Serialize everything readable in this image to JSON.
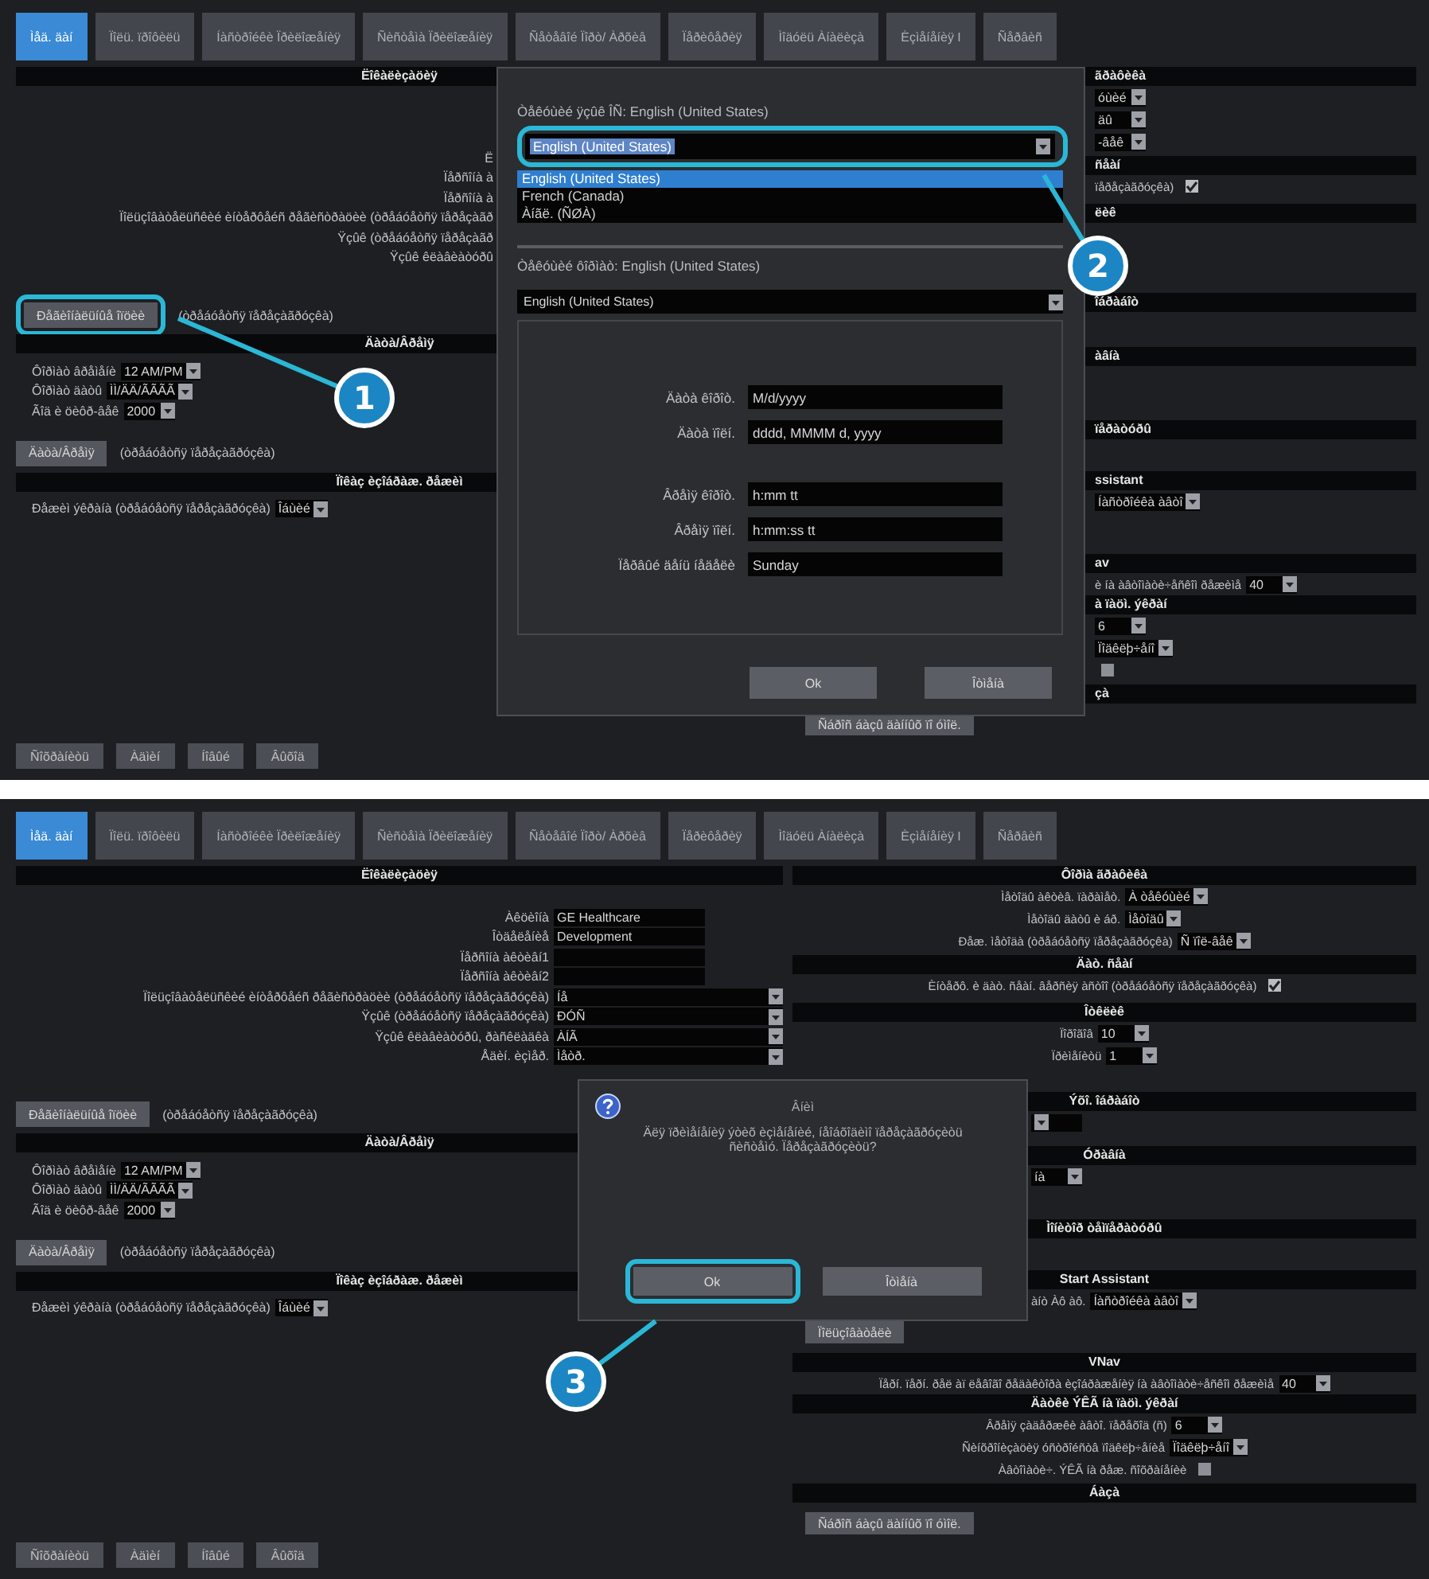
{
  "panels": [
    {
      "tabs": [
        {
          "label": "Ìåä. äàí",
          "selected": true
        },
        {
          "label": "Ïîëü. ïðîôèëü",
          "selected": false
        },
        {
          "label": "Íàñòðîéêè Ïðèëîæåíèÿ",
          "selected": false
        },
        {
          "label": "Ñèñòåìà Ïðèëîæåíèÿ",
          "selected": false
        },
        {
          "label": "Ñåòåâîé Ïîðò/ Àðõèâ",
          "selected": false
        },
        {
          "label": "Ïåðèôåðèÿ",
          "selected": false
        },
        {
          "label": "Ìîäóëü Àíàëèçà",
          "selected": false
        },
        {
          "label": "Èçìåíåíèÿ I",
          "selected": false
        },
        {
          "label": "Ñåðâèñ",
          "selected": false
        }
      ],
      "left": [
        {
          "kind": "form",
          "title": "Ëîêàëèçàöèÿ",
          "rows": [
            {
              "kind": "label",
              "label": "Ë"
            },
            {
              "kind": "label",
              "label": "Ïåðñîíà à"
            },
            {
              "kind": "label",
              "label": "Ïåðñîíà à"
            },
            {
              "kind": "label",
              "label": "Ïîëüçîâàòåëüñêèé èíòåðôåéñ ðåãèñòðàöèè (òðåáóåòñÿ ïåðåçàãð"
            },
            {
              "kind": "label",
              "label": "Ÿçûê (òðåáóåòñÿ ïåðåçàãð"
            },
            {
              "kind": "label",
              "label": "Ÿçûê êëàâèàòóðû"
            }
          ]
        },
        {
          "kind": "bar",
          "rows": [
            {
              "kind": "button",
              "label": "Ðåãèîíàëüíûå îïöèè",
              "note": "(òðåáóåòñÿ ïåðåçàãðóçêà)",
              "highlighted": true
            }
          ]
        },
        {
          "kind": "list",
          "title": "Äàòà/Âðåìÿ",
          "rows": [
            {
              "kind": "select",
              "label": "Ôîðìàò âðåìåíè",
              "value": "12 AM/PM"
            },
            {
              "kind": "select",
              "label": "Ôîðìàò äàòû",
              "value": "ÌÌ/ÄÄ/ÃÃÃÃ"
            },
            {
              "kind": "select",
              "label": "Ãîä è öèôð-âåê",
              "value": "2000"
            }
          ]
        },
        {
          "kind": "bar",
          "rows": [
            {
              "kind": "button",
              "label": "Äàòà/Âðåìÿ",
              "note": "(òðåáóåòñÿ ïåðåçàãðóçêà)",
              "highlighted": false
            }
          ]
        },
        {
          "kind": "list",
          "title": "Ïîêàç èçîáðàæ. ðåæèì",
          "rows": [
            {
              "kind": "select",
              "label": "Ðåæèì ýêðàíà (òðåáóåòñÿ ïåðåçàãðóçêà)",
              "value": "Îáùèé"
            }
          ]
        }
      ],
      "right": [
        {
          "title": "ãðàôèêà",
          "partial": true,
          "rows": [
            {
              "kind": "select",
              "value": "óùèé",
              "partial": true
            },
            {
              "kind": "select",
              "value": "äû",
              "partial": true
            },
            {
              "kind": "select",
              "value": "-âåê",
              "partial": true
            }
          ]
        },
        {
          "title": "ñåàí",
          "partial": true,
          "rows": [
            {
              "kind": "check",
              "label": "ïåðåçàãðóçêà)",
              "checked": true,
              "partial": true
            }
          ]
        },
        {
          "title": "ëèê",
          "partial": true
        },
        {
          "title": "îáðàáîò",
          "partial": true
        },
        {
          "title": "àâíà",
          "partial": true
        },
        {
          "title": "ïåðàòóðû",
          "partial": true
        },
        {
          "title": "ssistant",
          "partial": true,
          "rows": [
            {
              "kind": "select",
              "value": "Íàñòðîéêà àâòî",
              "partial": true
            }
          ]
        },
        {
          "title": "av",
          "partial": true,
          "rows": [
            {
              "kind": "select",
              "label": "è íà àâòîìàòè÷åñêîì ðåæèìå",
              "value": "40",
              "partial": true
            }
          ]
        },
        {
          "title": "à ïàöì. ýêðàí",
          "partial": true,
          "rows": [
            {
              "kind": "select",
              "value": "6",
              "partial": true
            },
            {
              "kind": "select",
              "value": "Ïîäêëþ÷åíî",
              "partial": true
            },
            {
              "kind": "check",
              "checked": false
            }
          ]
        },
        {
          "title": "çà",
          "partial": true,
          "rows": [
            {
              "kind": "button",
              "label": "Ñáðîñ áàçû äàííûõ ïî óìîë."
            }
          ]
        }
      ],
      "footer": [
        "Ñîõðàíèòü",
        "Àäìèí",
        "Íîâûé",
        "Âûõîä"
      ],
      "dialog": {
        "kind": "locale",
        "current_label": "Òåêóùèé ÿçûê ÎÑ: English (United States)",
        "current": "English (United States)",
        "highlighted": true,
        "options": [
          {
            "label": "English (United States)",
            "selected": true
          },
          {
            "label": "French (Canada)",
            "selected": false
          },
          {
            "label": "Àíãë. (ÑØÀ)",
            "selected": false
          }
        ],
        "format_label": "Òåêóùèé ôîðìàò: English (United States)",
        "format": "English (United States)",
        "date_formats": [
          {
            "label": "Äàòà êîðîò.",
            "value": "M/d/yyyy"
          },
          {
            "label": "Äàòà ïîëí.",
            "value": "dddd, MMMM d, yyyy"
          }
        ],
        "time_formats": [
          {
            "label": "Âðåìÿ êîðîò.",
            "value": "h:mm tt"
          },
          {
            "label": "Âðåìÿ ïîëí.",
            "value": "h:mm:ss tt"
          },
          {
            "label": "Ïåðâûé äåíü íåäåëè",
            "value": "Sunday"
          }
        ],
        "buttons": [
          {
            "label": "Ok",
            "highlighted": false
          },
          {
            "label": "Îòìåíà",
            "highlighted": false
          }
        ]
      },
      "callouts": [
        {
          "number": "1"
        },
        {
          "number": "2"
        }
      ]
    },
    {
      "tabs": [
        {
          "label": "Ìåä. äàí",
          "selected": true
        },
        {
          "label": "Ïîëü. ïðîôèëü",
          "selected": false
        },
        {
          "label": "Íàñòðîéêè Ïðèëîæåíèÿ",
          "selected": false
        },
        {
          "label": "Ñèñòåìà Ïðèëîæåíèÿ",
          "selected": false
        },
        {
          "label": "Ñåòåâîé Ïîðò/ Àðõèâ",
          "selected": false
        },
        {
          "label": "Ïåðèôåðèÿ",
          "selected": false
        },
        {
          "label": "Ìîäóëü Àíàëèçà",
          "selected": false
        },
        {
          "label": "Èçìåíåíèÿ I",
          "selected": false
        },
        {
          "label": "Ñåðâèñ",
          "selected": false
        }
      ],
      "left": [
        {
          "kind": "form",
          "title": "Ëîêàëèçàöèÿ",
          "rows": [
            {
              "kind": "field",
              "label": "Àêöèîíà",
              "value": "GE Healthcare"
            },
            {
              "kind": "field",
              "label": "Îòäåëåíèå",
              "value": "Development"
            },
            {
              "kind": "field",
              "label": "Ïåðñîíà àêòèâí1"
            },
            {
              "kind": "field",
              "label": "Ïåðñîíà àêòèâí2"
            },
            {
              "kind": "select",
              "label": "Ïîëüçîâàòåëüñêèé èíòåðôåéñ ðåãèñòðàöèè (òðåáóåòñÿ ïåðåçàãðóçêà)",
              "value": "Íå"
            },
            {
              "kind": "select",
              "label": "Ÿçûê (òðåáóåòñÿ ïåðåçàãðóçêà)",
              "value": "ÐÓÑ"
            },
            {
              "kind": "select",
              "label": "Ÿçûê êëàâèàòóðû, ðàñêëàäêà",
              "value": "ÀÍÃ"
            },
            {
              "kind": "select",
              "label": "Åäèí. èçìåð.",
              "value": "Ìåòð."
            }
          ]
        },
        {
          "kind": "bar",
          "rows": [
            {
              "kind": "button",
              "label": "Ðåãèîíàëüíûå îïöèè",
              "note": "(òðåáóåòñÿ ïåðåçàãðóçêà)",
              "highlighted": false
            }
          ]
        },
        {
          "kind": "list",
          "title": "Äàòà/Âðåìÿ",
          "rows": [
            {
              "kind": "select",
              "label": "Ôîðìàò âðåìåíè",
              "value": "12 AM/PM"
            },
            {
              "kind": "select",
              "label": "Ôîðìàò äàòû",
              "value": "ÌÌ/ÄÄ/ÃÃÃÃ"
            },
            {
              "kind": "select",
              "label": "Ãîä è öèôð-âåê",
              "value": "2000"
            }
          ]
        },
        {
          "kind": "bar",
          "rows": [
            {
              "kind": "button",
              "label": "Äàòà/Âðåìÿ",
              "note": "(òðåáóåòñÿ ïåðåçàãðóçêà)",
              "highlighted": false
            }
          ]
        },
        {
          "kind": "list",
          "title": "Ïîêàç èçîáðàæ. ðåæèì",
          "rows": [
            {
              "kind": "select",
              "label": "Ðåæèì ýêðàíà (òðåáóåòñÿ ïåðåçàãðóçêà)",
              "value": "Îáùèé"
            }
          ]
        }
      ],
      "right": [
        {
          "title": "Ôîðìà ãðàôèêà",
          "partial": false,
          "rows": [
            {
              "kind": "select",
              "label": "Ìåòîäû àêòèâ. ïàðàìåò.",
              "value": "À òåêóùèé",
              "partial": false
            },
            {
              "kind": "select",
              "label": "Ìåòîäû äàòû è áð.",
              "value": "Ìåòîäû",
              "partial": false
            },
            {
              "kind": "select",
              "label": "Ðåæ. ìåòîäà (òðåáóåòñÿ ïåðåçàãðóçêà)",
              "value": "Ñ ïîë-âåê",
              "partial": false
            }
          ]
        },
        {
          "title": "Äàò. ñåàí",
          "partial": false,
          "rows": [
            {
              "kind": "check",
              "label": "Èíòåðô. è äàò. ñåàí. âåðñèÿ àñòîî (òðåáóåòñÿ ïåðåçàãðóçêà)",
              "checked": true,
              "partial": false
            }
          ]
        },
        {
          "title": "Îòêëèê",
          "partial": false,
          "rows": [
            {
              "kind": "select",
              "label": "Ïîðîãîâ",
              "value": "10",
              "partial": false
            },
            {
              "kind": "select",
              "label": "Ïðèìåíèòü",
              "value": "1",
              "partial": false
            }
          ]
        },
        {
          "title": "Ýõî. îáðàáîò",
          "partial": false,
          "rows": [
            {
              "kind": "select",
              "partial": true
            }
          ]
        },
        {
          "title": "Óðàâíà",
          "partial": false,
          "rows": [
            {
              "kind": "select",
              "value": "íà",
              "partial": true
            }
          ]
        },
        {
          "title": "Ìîíèòîð òåìïåðàòóðû",
          "partial": false
        },
        {
          "title": "Start Assistant",
          "partial": false,
          "rows": [
            {
              "kind": "select",
              "label": "àíò Àô àô.",
              "value": "Íàñòðîéêà àâòî",
              "partial": true
            },
            {
              "kind": "button",
              "label": "Ïîëüçîâàòåëè"
            }
          ]
        },
        {
          "title": "VNav",
          "partial": false,
          "rows": [
            {
              "kind": "select",
              "label": "Ïåðí. ïåðí. ðåë àï ëåâîãî ðåäàêòîðà èçîáðàæåíèÿ íà àâòîìàòè÷åñêîì ðåæèìå",
              "value": "40",
              "partial": false
            }
          ]
        },
        {
          "title": "Äàòêè ÝÊÃ íà ïàöì. ýêðàí",
          "partial": false,
          "rows": [
            {
              "kind": "select",
              "label": "Âðåìÿ çàäåðæêè àâòî. ïåðåõîä (ñ)",
              "value": "6",
              "partial": false
            },
            {
              "kind": "select",
              "label": "Ñèíõðîíèçàöèÿ óñòðîéñòâ ïîäêëþ÷åíèå",
              "value": "Ïîäêëþ÷åíî",
              "partial": false
            },
            {
              "kind": "check",
              "label": "Àâòîìàòè÷. ÝÊÃ íà ðåæ. ñîõðàíåíèè",
              "checked": false,
              "partial": false
            }
          ]
        },
        {
          "title": "Áàçà",
          "partial": false,
          "rows": [
            {
              "kind": "button",
              "label": "Ñáðîñ áàçû äàííûõ ïî óìîë."
            }
          ]
        }
      ],
      "footer": [
        "Ñîõðàíèòü",
        "Àäìèí",
        "Íîâûé",
        "Âûõîä"
      ],
      "dialog": {
        "kind": "confirm",
        "title": "Âíèì",
        "message": "Äëÿ ïðèìåíåíèÿ ýòèõ èçìåíåíèé, íåîáõîäèìî ïåðåçàãðóçèòü ñèñòåìó. Ïåðåçàãðóçèòü?",
        "buttons": [
          {
            "label": "Ok",
            "highlighted": true
          },
          {
            "label": "Îòìåíà",
            "highlighted": false
          }
        ]
      },
      "callouts": [
        {
          "number": "3"
        }
      ]
    }
  ]
}
